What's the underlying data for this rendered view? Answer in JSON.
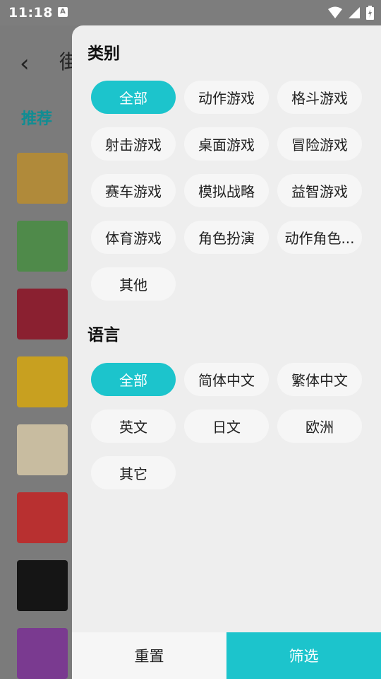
{
  "status_bar": {
    "time": "11:18",
    "notification_icon": "A"
  },
  "background": {
    "title_partial": "街",
    "section_label": "推荐",
    "thumbnails": [
      {
        "name": "game-thumb-1",
        "color": "#b08a3a"
      },
      {
        "name": "game-thumb-2",
        "color": "#4f8a4a"
      },
      {
        "name": "game-thumb-3",
        "color": "#8a2030"
      },
      {
        "name": "game-thumb-4",
        "color": "#c8a020"
      },
      {
        "name": "game-thumb-5",
        "color": "#c8bca0"
      },
      {
        "name": "game-thumb-6",
        "color": "#b83030"
      },
      {
        "name": "game-thumb-7",
        "color": "#151515"
      },
      {
        "name": "game-thumb-8",
        "color": "#7a3a90"
      }
    ]
  },
  "drawer": {
    "category": {
      "title": "类别",
      "options": [
        "全部",
        "动作游戏",
        "格斗游戏",
        "射击游戏",
        "桌面游戏",
        "冒险游戏",
        "赛车游戏",
        "模拟战略",
        "益智游戏",
        "体育游戏",
        "角色扮演",
        "动作角色...",
        "其他"
      ],
      "selected": "全部"
    },
    "language": {
      "title": "语言",
      "options": [
        "全部",
        "简体中文",
        "繁体中文",
        "英文",
        "日文",
        "欧洲",
        "其它"
      ],
      "selected": "全部"
    },
    "reset_label": "重置",
    "filter_label": "筛选"
  },
  "colors": {
    "accent": "#1cc4cc",
    "chip_bg": "#f6f6f6",
    "drawer_bg": "#eeeeee"
  }
}
